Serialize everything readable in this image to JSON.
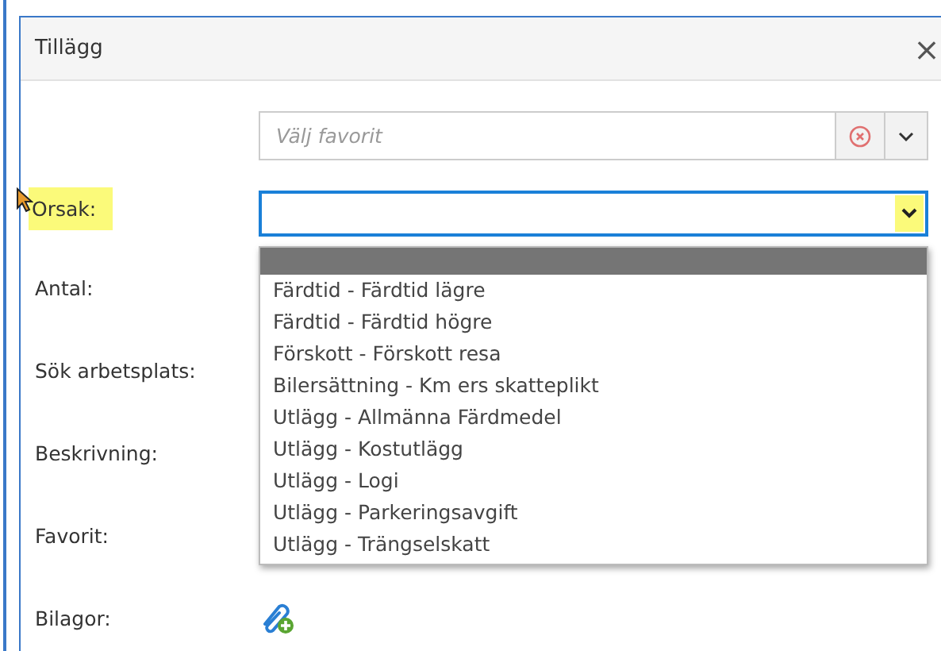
{
  "dialog": {
    "title": "Tillägg",
    "close": "×"
  },
  "favorite_picker": {
    "placeholder": "Välj favorit"
  },
  "form": {
    "fields": [
      {
        "label": "Orsak:",
        "kind": "select",
        "highlighted": true
      },
      {
        "label": "Antal:",
        "kind": "blank",
        "highlighted": false
      },
      {
        "label": "Sök arbetsplats:",
        "kind": "blank",
        "highlighted": false
      },
      {
        "label": "Beskrivning:",
        "kind": "blank",
        "highlighted": false
      },
      {
        "label": "Favorit:",
        "kind": "blank",
        "highlighted": false
      },
      {
        "label": "Bilagor:",
        "kind": "attach",
        "highlighted": false
      }
    ]
  },
  "orsak_select": {
    "expanded": true,
    "arrow_highlighted": true,
    "options": [
      {
        "selected": true
      },
      {
        "label": "Färdtid - Färdtid lägre",
        "selected": false
      },
      {
        "label": "Färdtid - Färdtid högre",
        "selected": false
      },
      {
        "label": "Förskott - Förskott resa",
        "selected": false
      },
      {
        "label": "Bilersättning - Km ers skatteplikt",
        "selected": false
      },
      {
        "label": "Utlägg - Allmänna Färdmedel",
        "selected": false
      },
      {
        "label": "Utlägg - Kostutlägg",
        "selected": false
      },
      {
        "label": "Utlägg - Logi",
        "selected": false
      },
      {
        "label": "Utlägg - Parkeringsavgift",
        "selected": false
      },
      {
        "label": "Utlägg - Trängselskatt",
        "selected": false
      }
    ]
  }
}
